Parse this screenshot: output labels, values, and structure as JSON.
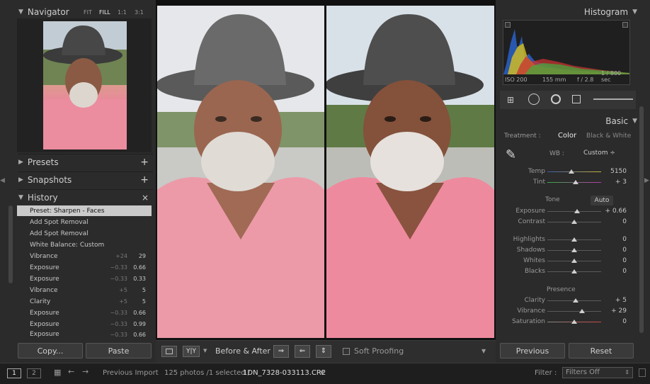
{
  "navigator": {
    "title": "Navigator",
    "zoom": [
      "FIT",
      "FILL",
      "1:1",
      "3:1"
    ]
  },
  "presets": {
    "title": "Presets"
  },
  "snapshots": {
    "title": "Snapshots"
  },
  "history": {
    "title": "History",
    "items": [
      {
        "label": "Preset: Sharpen - Faces",
        "v1": "",
        "v2": ""
      },
      {
        "label": "Add Spot Removal",
        "v1": "",
        "v2": ""
      },
      {
        "label": "Add Spot Removal",
        "v1": "",
        "v2": ""
      },
      {
        "label": "White Balance: Custom",
        "v1": "",
        "v2": ""
      },
      {
        "label": "Vibrance",
        "v1": "+24",
        "v2": "29"
      },
      {
        "label": "Exposure",
        "v1": "−0.33",
        "v2": "0.66"
      },
      {
        "label": "Exposure",
        "v1": "−0.33",
        "v2": "0.33"
      },
      {
        "label": "Vibrance",
        "v1": "+5",
        "v2": "5"
      },
      {
        "label": "Clarity",
        "v1": "+5",
        "v2": "5"
      },
      {
        "label": "Exposure",
        "v1": "−0.33",
        "v2": "0.66"
      },
      {
        "label": "Exposure",
        "v1": "−0.33",
        "v2": "0.99"
      },
      {
        "label": "Exposure",
        "v1": "−0.33",
        "v2": "0.66"
      }
    ]
  },
  "left_buttons": {
    "copy": "Copy...",
    "paste": "Paste"
  },
  "toolbar": {
    "before_after": "Before & After :",
    "soft_proofing": "Soft Proofing"
  },
  "histogram": {
    "title": "Histogram",
    "iso": "ISO 200",
    "focal": "155 mm",
    "aperture": "f / 2.8",
    "shutter": "1 / 800 sec"
  },
  "basic": {
    "title": "Basic",
    "treatment_label": "Treatment :",
    "color": "Color",
    "bw": "Black & White",
    "wb_label": "WB :",
    "wb_value": "Custom ÷",
    "temp": {
      "label": "Temp",
      "value": "5150",
      "pos": 0.45
    },
    "tint": {
      "label": "Tint",
      "value": "+ 3",
      "pos": 0.52
    },
    "tone": "Tone",
    "auto": "Auto",
    "exposure": {
      "label": "Exposure",
      "value": "+ 0.66",
      "pos": 0.55
    },
    "contrast": {
      "label": "Contrast",
      "value": "0",
      "pos": 0.5
    },
    "highlights": {
      "label": "Highlights",
      "value": "0",
      "pos": 0.5
    },
    "shadows": {
      "label": "Shadows",
      "value": "0",
      "pos": 0.5
    },
    "whites": {
      "label": "Whites",
      "value": "0",
      "pos": 0.5
    },
    "blacks": {
      "label": "Blacks",
      "value": "0",
      "pos": 0.5
    },
    "presence": "Presence",
    "clarity": {
      "label": "Clarity",
      "value": "+ 5",
      "pos": 0.52
    },
    "vibrance": {
      "label": "Vibrance",
      "value": "+ 29",
      "pos": 0.65
    },
    "saturation": {
      "label": "Saturation",
      "value": "0",
      "pos": 0.5
    }
  },
  "right_buttons": {
    "previous": "Previous",
    "reset": "Reset"
  },
  "filmstrip": {
    "page1": "1",
    "page2": "2",
    "source": "Previous Import",
    "count": "125 photos /1 selected /",
    "filename": "1DN_7328-033113.CR2",
    "filter_label": "Filter :",
    "filter_value": "Filters Off"
  }
}
